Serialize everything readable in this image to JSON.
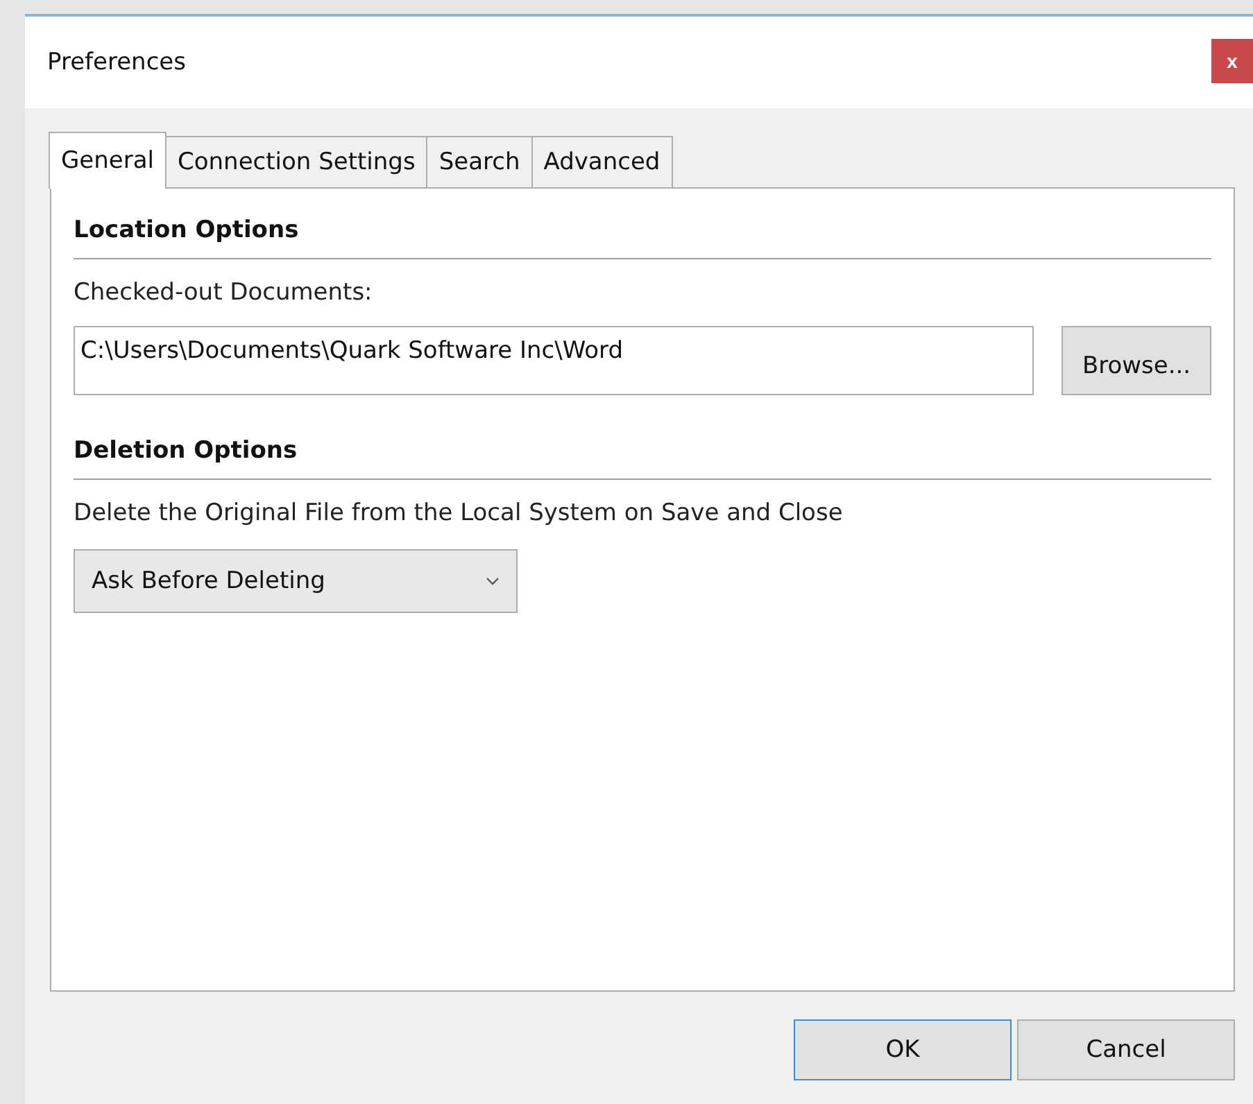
{
  "window": {
    "title": "Preferences",
    "close": "x"
  },
  "tabs": [
    {
      "label": "General",
      "selected": true
    },
    {
      "label": "Connection Settings",
      "selected": false
    },
    {
      "label": "Search",
      "selected": false
    },
    {
      "label": "Advanced",
      "selected": false
    }
  ],
  "sections": [
    {
      "heading": "Location Options",
      "label": "Checked-out Documents:",
      "kind": "path",
      "value": "C:\\Users\\Documents\\Quark Software Inc\\Word",
      "button": "Browse..."
    },
    {
      "heading": "Deletion Options",
      "label": "Delete the Original File from the Local System on Save and Close",
      "kind": "dropdown",
      "value": "Ask Before Deleting"
    }
  ],
  "buttons": [
    {
      "label": "OK",
      "default": true
    },
    {
      "label": "Cancel",
      "default": false
    }
  ]
}
